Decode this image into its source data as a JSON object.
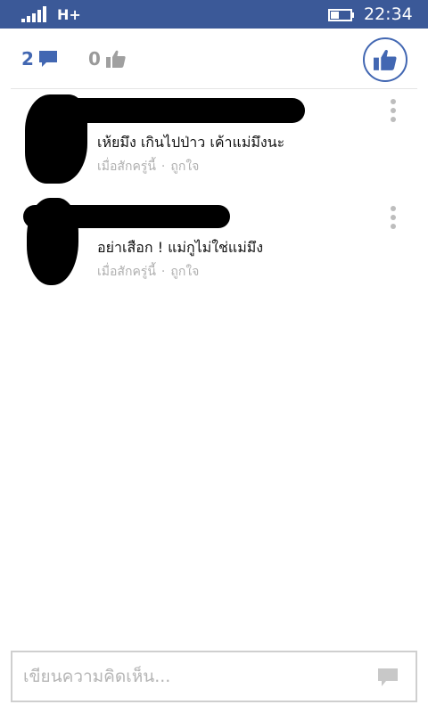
{
  "status_bar": {
    "network": "H+",
    "time": "22:34"
  },
  "counts": {
    "comments": "2",
    "likes": "0"
  },
  "comments": [
    {
      "text": "เห้ยมึง เกินไปป่าว เค้าแม่มึงนะ",
      "time": "เมื่อสักครู่นี้",
      "like_label": "ถูกใจ"
    },
    {
      "text": "อย่าเสือก ! แม่กูไม่ใช่แม่มึง",
      "time": "เมื่อสักครู่นี้",
      "like_label": "ถูกใจ"
    }
  ],
  "composer": {
    "placeholder": "เขียนความคิดเห็น..."
  },
  "colors": {
    "status_bar": "#3b5998",
    "accent": "#4267b2",
    "muted": "#9a9a9a"
  }
}
